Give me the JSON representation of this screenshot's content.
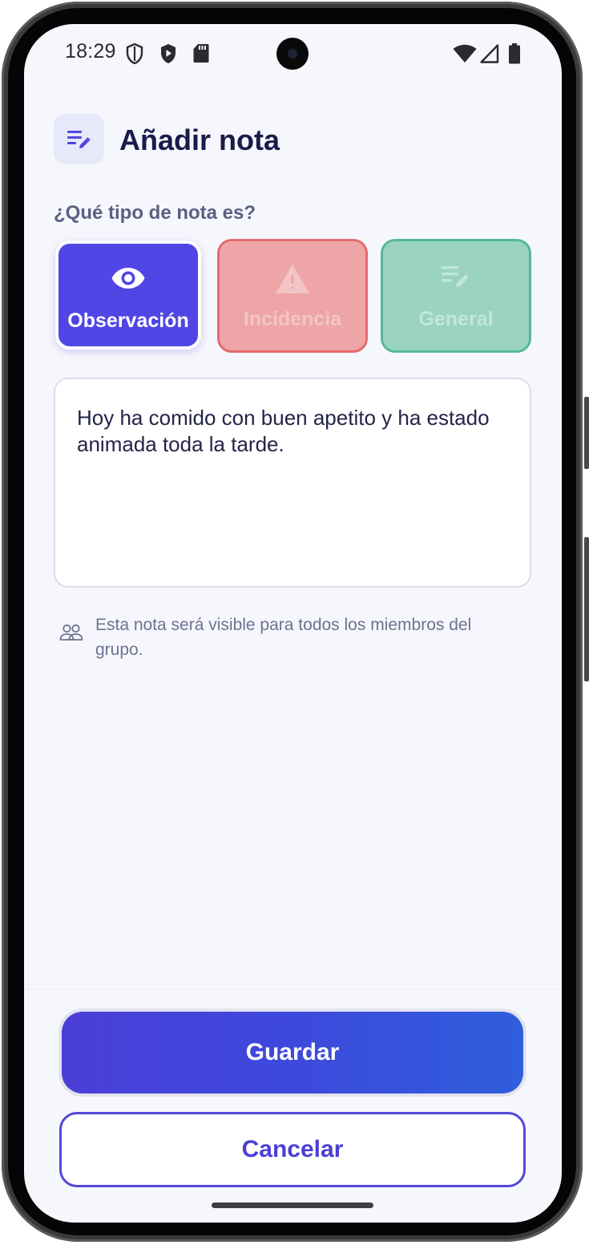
{
  "status_bar": {
    "time": "18:29",
    "left_icons": [
      "shield-outline-icon",
      "shield-play-icon",
      "sd-card-icon"
    ],
    "right_icons": [
      "wifi-icon",
      "signal-icon",
      "battery-icon"
    ]
  },
  "header": {
    "icon": "edit-note-icon",
    "title": "Añadir nota"
  },
  "note_type": {
    "question": "¿Qué tipo de nota es?",
    "options": [
      {
        "label": "Observación",
        "icon": "eye-icon",
        "selected": true,
        "color": "#4f46e5"
      },
      {
        "label": "Incidencia",
        "icon": "warning-icon",
        "selected": false,
        "color": "#e46a6e"
      },
      {
        "label": "General",
        "icon": "edit-note-icon",
        "selected": false,
        "color": "#55b899"
      }
    ]
  },
  "note": {
    "value": "Hoy ha comido con buen apetito y ha estado animada toda la tarde."
  },
  "visibility": {
    "icon": "group-icon",
    "text": "Esta nota será visible para todos los miembros del grupo."
  },
  "actions": {
    "save_label": "Guardar",
    "cancel_label": "Cancelar"
  },
  "colors": {
    "primary": "#4f46e5",
    "background": "#f6f7fc",
    "title": "#1c1a4a"
  }
}
